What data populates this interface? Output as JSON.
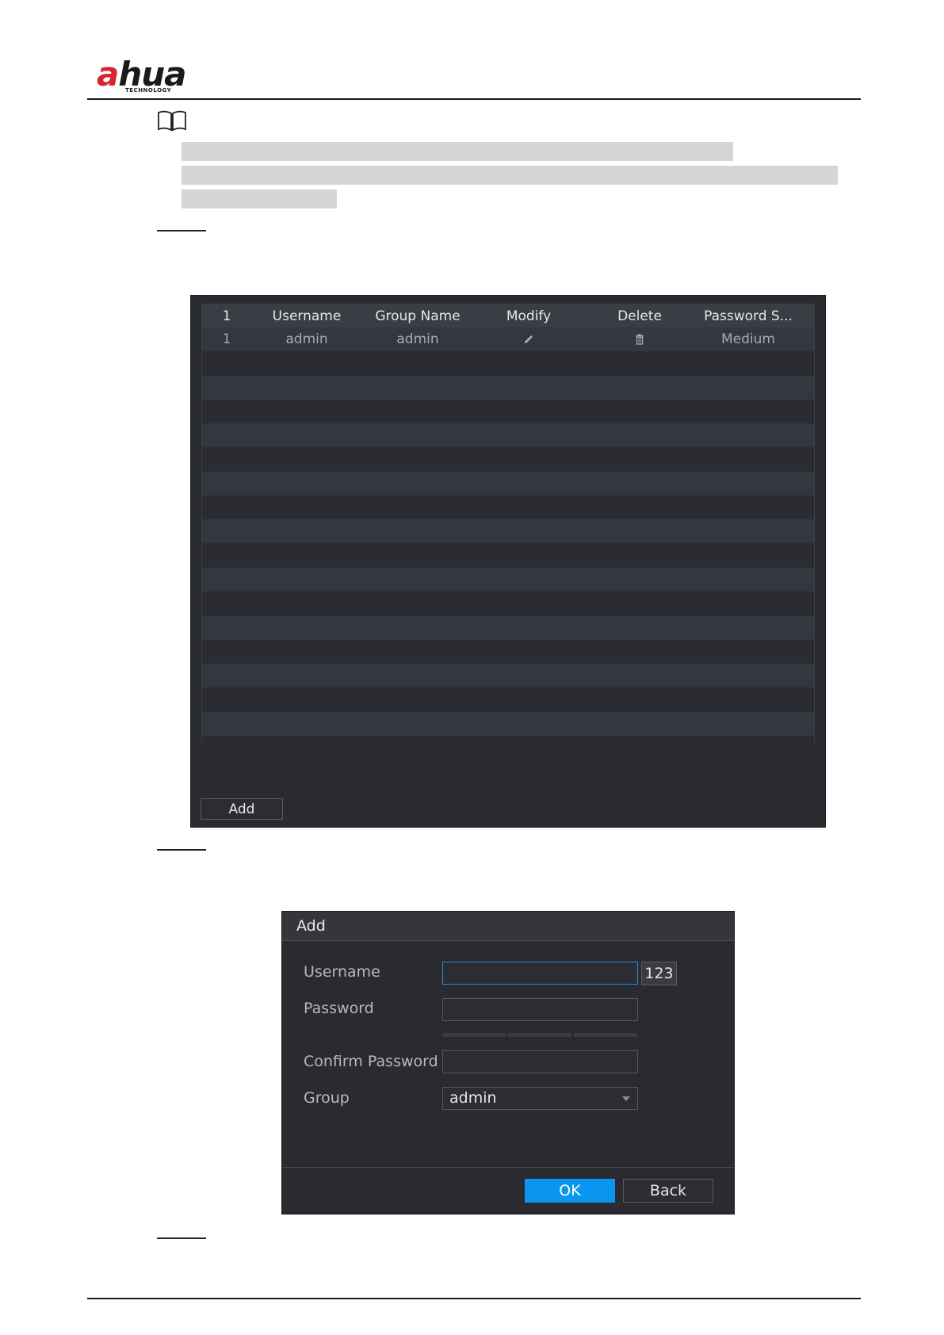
{
  "logo": {
    "text_a": "a",
    "text_rest": "hua",
    "sub": "TECHNOLOGY",
    "brand_color": "#d9232e"
  },
  "user_table": {
    "columns": [
      "1",
      "Username",
      "Group Name",
      "Modify",
      "Delete",
      "Password S..."
    ],
    "rows": [
      {
        "index": "1",
        "username": "admin",
        "group": "admin",
        "modify_icon": "pencil-icon",
        "delete_icon": "trash-icon",
        "password_strength": "Medium"
      }
    ],
    "add_label": "Add"
  },
  "add_dialog": {
    "title": "Add",
    "username_label": "Username",
    "keyboard_label": "123",
    "password_label": "Password",
    "confirm_password_label": "Confirm Password",
    "group_label": "Group",
    "group_value": "admin",
    "ok_label": "OK",
    "back_label": "Back"
  },
  "colors": {
    "accent": "#0a96f0",
    "focus_border": "#1e8fe0",
    "panel_bg": "#2a2b30"
  }
}
